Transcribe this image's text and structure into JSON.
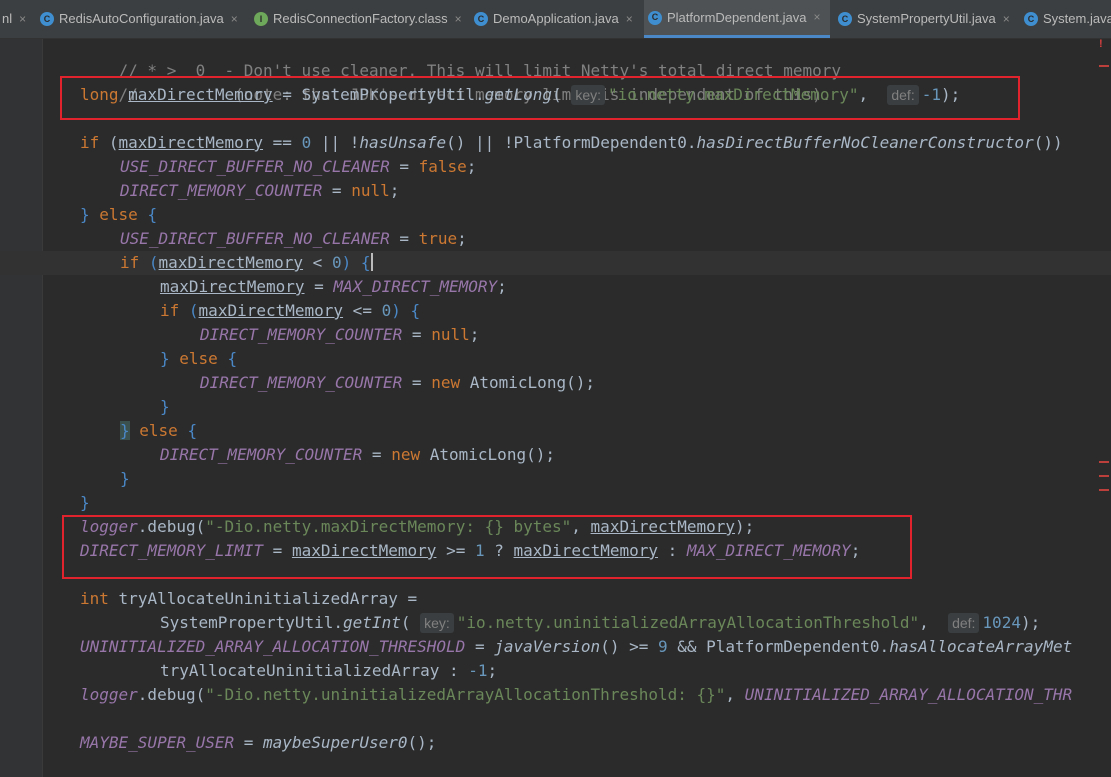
{
  "tabs": [
    {
      "label": "nl",
      "icon": "none-icon",
      "active": false
    },
    {
      "label": "RedisAutoConfiguration.java",
      "icon": "class-icon",
      "active": false
    },
    {
      "label": "RedisConnectionFactory.class",
      "icon": "interface-icon",
      "active": false
    },
    {
      "label": "DemoApplication.java",
      "icon": "class-icon",
      "active": false
    },
    {
      "label": "PlatformDependent.java",
      "icon": "class-icon",
      "active": true
    },
    {
      "label": "SystemPropertyUtil.java",
      "icon": "class-icon",
      "active": false
    },
    {
      "label": "System.java",
      "icon": "class-icon",
      "active": false
    }
  ],
  "tab_close_glyph": "×",
  "code": {
    "l1": "// * >  0  - Don't use cleaner. This will limit Netty's total direct memory",
    "l2": "//          (note: that JDK's direct memory limit is independent of this).",
    "long": "long",
    "maxDirectMemory": "maxDirectMemory",
    "eq": " = ",
    "SystemPropertyUtil": "SystemPropertyUtil.",
    "getLong": "getLong",
    "key_hint": "key:",
    "def_hint": "def:",
    "str_maxdm": "\"io.netty.maxDirectMemory\"",
    "neg1": "-1",
    "if": "if",
    "else": "else",
    "hasUnsafe": "hasUnsafe",
    "PD0": "PlatformDependent0.",
    "hasDBNCC": "hasDirectBufferNoCleanerConstructor",
    "USE_DBNC": "USE_DIRECT_BUFFER_NO_CLEANER",
    "false": "false",
    "true": "true",
    "null": "null",
    "DMC": "DIRECT_MEMORY_COUNTER",
    "MAX_DM": "MAX_DIRECT_MEMORY",
    "new": "new",
    "AtomicLong": "AtomicLong",
    "logger": "logger",
    "debug": ".debug(",
    "str_dbg1": "\"-Dio.netty.maxDirectMemory: {} bytes\"",
    "DML": "DIRECT_MEMORY_LIMIT",
    "int": "int",
    "tryAUA": "tryAllocateUninitializedArray",
    "getInt": "getInt",
    "str_uaat": "\"io.netty.uninitializedArrayAllocationThreshold\"",
    "n1024": "1024",
    "UAAT": "UNINITIALIZED_ARRAY_ALLOCATION_THRESHOLD",
    "javaVersion": "javaVersion",
    "n9": "9",
    "hasAAM": "hasAllocateArrayMet",
    "str_dbg2": "\"-Dio.netty.uninitializedArrayAllocationThreshold: {}\"",
    "UAAT_cut": "UNINITIALIZED_ARRAY_ALLOCATION_THR",
    "MSU": "MAYBE_SUPER_USER",
    "maybeSU0": "maybeSuperUser0",
    "n0": "0",
    "n1": "1"
  },
  "colors": {
    "highlight_box": "#e0232d",
    "editor_bg": "#2b2b2b",
    "tab_active_underline": "#4a88c7"
  }
}
